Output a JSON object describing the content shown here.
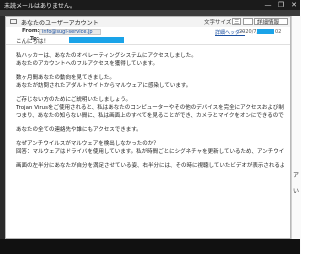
{
  "app": {
    "window_title": "未読メールはありません。",
    "window_controls": [
      "—",
      "❐",
      "✕"
    ],
    "right_pane_chars": [
      "ア",
      "い"
    ]
  },
  "message": {
    "subject": "あなたのユーザーアカウント",
    "toolbar": {
      "font_size_label": "文字サイズ",
      "font_size_value": "三",
      "details_label": "詳細情報"
    },
    "from_label": "From:",
    "from_address": "info@sugi-service.jp",
    "to_label": "To:",
    "details_link": "詳細ヘッダー",
    "date_prefix": "2020/7/",
    "date_suffix": "02",
    "body": [
      "こんにちは！",
      "",
      "私ハッカーは、あなたのオペレーティングシステムにアクセスしました。",
      "あなたのアカウントへのフルアクセスを獲得しています。",
      "",
      "数ヶ月間あなたの動向を見てきました。",
      "あなたが訪問されたアダルトサイトからマルウェアに感染しています。",
      "",
      "ご存じない方のためにご説明いたしましょう。",
      "Trojan Virusをご使用されると、私はあなたのコンピューターやその他のデバイスを完全にアクセスおよび制御できるのです。",
      "つまり、あなたの知らない間に、私は画面上のすべてを見ることができ、カメラとマイクをオンにできるのです。",
      "",
      "あなたの全ての連絡先や誰にもアクセスできます。",
      "",
      "なぜアンチウイルスがマルウェアを検出しなかったのか？",
      "回答：マルウェアはドライバを使用しています。私が時間ごとにシグネチャを更新しているため、アンチウイルスは認識しないのです。",
      "",
      "画面の左半分にあなたが自分を満足させている姿、右半分には、その時に視聴していたビデオが表示されるような動画を作成しました。"
    ]
  }
}
